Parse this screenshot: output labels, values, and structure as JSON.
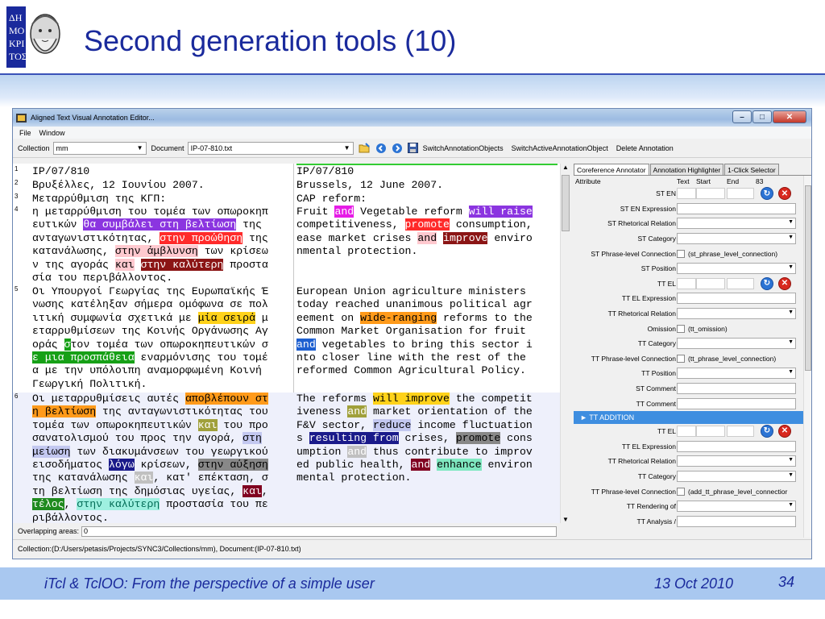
{
  "slide": {
    "title": "Second generation tools (10)",
    "footer_left": "iTcl & TclOO: From the perspective of a simple user",
    "footer_date": "13 Oct 2010",
    "footer_page": "34",
    "logo_text": "ΔΗΜΟΚΡΙΤΟΣ",
    "colors": {
      "title": "#1a2a9c",
      "band": "#a9c8f0"
    }
  },
  "window": {
    "title": "Aligned Text Visual Annotation Editor...",
    "buttons": [
      "minimize-icon",
      "maximize-icon",
      "close-icon"
    ]
  },
  "menu": {
    "file": "File",
    "window": "Window"
  },
  "toolbar": {
    "collection_label": "Collection",
    "collection_value": "mm",
    "document_label": "Document",
    "document_value": "IP-07-810.txt",
    "switch_objects": "SwitchAnnotationObjects",
    "switch_active": "SwitchActiveAnnotationObject",
    "delete": "Delete Annotation",
    "icons": [
      "open-folder-icon",
      "back-arrow-icon",
      "forward-arrow-icon",
      "save-icon"
    ]
  },
  "segments": [
    {
      "num": "1",
      "greek": [
        "IP/07/810"
      ],
      "english": [
        "IP/07/810"
      ]
    },
    {
      "num": "2",
      "greek": [
        "Βρυξέλλες, 12 Ιουνίου 2007."
      ],
      "english": [
        "Brussels, 12 June 2007."
      ]
    },
    {
      "num": "3",
      "greek": [
        "Μεταρρύθμιση της ΚΓΠ:"
      ],
      "english": [
        "CAP reform:"
      ]
    },
    {
      "num": "4",
      "greek": [
        "η μεταρρύθμιση του τομέα των οπωροκηπ",
        "ευτικών θα συμβάλει στη βελτίωση της",
        "ανταγωνιστικότητας, στην προώθηση της",
        "κατανάλωσης, στην άμβλυνση των κρίσεω",
        "ν της αγοράς και στην καλύτερη προστα",
        "σία του περιβάλλοντος."
      ],
      "english": [
        "Fruit and Vegetable reform will raise",
        "competitiveness, promote consumption,",
        "ease market crises and improve enviro",
        "nmental protection."
      ]
    },
    {
      "num": "5",
      "greek": [
        "Οι Υπουργοί Γεωργίας της Ευρωπαϊκής Έ",
        "νωσης κατέληξαν σήμερα ομόφωνα σε πολ",
        "ιτική συμφωνία σχετικά με μία σειρά μ",
        "εταρρυθμίσεων της Κοινής Οργάνωσης Αγ",
        "οράς στον τομέα των οπωροκηπευτικών σ",
        "ε μια προσπάθεια εναρμόνισης του τομέ",
        "α με την υπόλοιπη αναμορφωμένη Κοινή",
        "Γεωργική Πολιτική."
      ],
      "english": [
        "European Union agriculture ministers",
        "today reached unanimous political agr",
        "eement on wide-ranging reforms to the",
        "Common Market Organisation for fruit",
        "and vegetables to bring this sector i",
        "nto closer line with the rest of the",
        "reformed Common Agricultural Policy."
      ]
    },
    {
      "num": "6",
      "greek": [
        "Οι μεταρρυθμίσεις αυτές αποβλέπουν στ",
        "η βελτίωση της ανταγωνιστικότητας του",
        "τομέα των οπωροκηπευτικών και του προ",
        "σανατολισμού του προς την αγορά, στη",
        "μείωση των διακυμάνσεων του γεωργικού",
        "εισοδήματος λόγω κρίσεων, στην αύξηση",
        "της κατανάλωσης και, κατ' επέκταση, σ",
        "τη βελτίωση της δημόσιας υγείας, και,",
        "τέλος, στην καλύτερη προστασία του πε",
        "ριβάλλοντος."
      ],
      "english": [
        "The reforms will improve the competit",
        "iveness and market orientation of the",
        "F&V sector, reduce income fluctuation",
        "s resulting from crises, promote cons",
        "umption and thus contribute to improv",
        "ed public health, and enhance environ",
        "mental protection."
      ]
    }
  ],
  "overlap": {
    "label": "Overlapping areas:",
    "value": "0"
  },
  "status": "Collection:(D:/Users/petasis/Projects/SYNC3/Collections/mm), Document:(IP-07-810.txt)",
  "panel": {
    "tabs": [
      "Coreference Annotator",
      "Annotation Highlighter",
      "1-Click Selector"
    ],
    "header": {
      "attribute": "Attribute",
      "text": "Text",
      "start": "Start",
      "end": "End",
      "count": "83"
    },
    "rows": [
      {
        "label": "ST EN",
        "kind": "tt"
      },
      {
        "label": "ST EN Expression",
        "kind": "input"
      },
      {
        "label": "ST Rhetorical Relation",
        "kind": "select"
      },
      {
        "label": "ST Category",
        "kind": "select"
      },
      {
        "label": "ST Phrase-level Connection",
        "kind": "check",
        "check_text": "(st_phrase_level_connection)"
      },
      {
        "label": "ST Position",
        "kind": "select"
      },
      {
        "label": "TT EL",
        "kind": "tt"
      },
      {
        "label": "TT EL Expression",
        "kind": "input"
      },
      {
        "label": "TT Rhetorical Relation",
        "kind": "select"
      },
      {
        "label": "Omission",
        "kind": "check",
        "check_text": "(tt_omission)"
      },
      {
        "label": "TT Category",
        "kind": "select"
      },
      {
        "label": "TT Phrase-level Connection",
        "kind": "check",
        "check_text": "(tt_phrase_level_connection)"
      },
      {
        "label": "TT Position",
        "kind": "select"
      },
      {
        "label": "ST Comment",
        "kind": "input"
      },
      {
        "label": "TT Comment",
        "kind": "input"
      }
    ],
    "section": "► TT ADDITION",
    "rows2": [
      {
        "label": "TT EL",
        "kind": "tt"
      },
      {
        "label": "TT EL Expression",
        "kind": "input"
      },
      {
        "label": "TT Rhetorical Relation",
        "kind": "select"
      },
      {
        "label": "TT Category",
        "kind": "select"
      },
      {
        "label": "TT Phrase-level Connection",
        "kind": "check",
        "check_text": "(add_tt_phrase_level_connectior"
      },
      {
        "label": "TT Rendering of",
        "kind": "select"
      },
      {
        "label": "TT Analysis /",
        "kind": "input"
      }
    ]
  }
}
